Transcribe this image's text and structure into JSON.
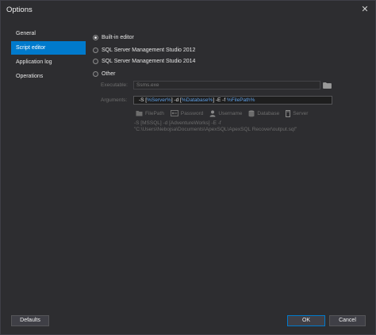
{
  "window": {
    "title": "Options"
  },
  "sidebar": {
    "items": [
      {
        "label": "General"
      },
      {
        "label": "Script editor"
      },
      {
        "label": "Application log"
      },
      {
        "label": "Operations"
      }
    ],
    "selected": "Script editor"
  },
  "editor": {
    "options": [
      {
        "label": "Built-in editor",
        "checked": true
      },
      {
        "label": "SQL Server Management Studio 2012",
        "checked": false
      },
      {
        "label": "SQL Server Management Studio 2014",
        "checked": false
      },
      {
        "label": "Other",
        "checked": false
      }
    ],
    "executable_label": "Executable:",
    "executable_value": "Ssms.exe",
    "arguments_label": "Arguments:",
    "arguments": {
      "p1": "-S [",
      "server": "%Server%",
      "p2": "] -d [",
      "database": "%Database%",
      "p3": "] -E -f ",
      "filepath": "%FilePath%"
    },
    "placeholders": [
      {
        "label": "FilePath",
        "icon": "file-icon"
      },
      {
        "label": "Password",
        "icon": "key-icon"
      },
      {
        "label": "Username",
        "icon": "user-icon"
      },
      {
        "label": "Database",
        "icon": "database-icon"
      },
      {
        "label": "Server",
        "icon": "server-icon"
      }
    ],
    "preview_line1": "-S [MSSQL] -d [AdventureWorks] -E -f",
    "preview_line2": "\"C:\\Users\\Nebojsa\\Documents\\ApexSQL\\ApexSQL Recover\\output.sql\""
  },
  "footer": {
    "defaults_label": "Defaults",
    "ok_label": "OK",
    "cancel_label": "Cancel"
  },
  "colors": {
    "background": "#2d2d30",
    "accent": "#007acc",
    "token": "#5d9ee5"
  }
}
